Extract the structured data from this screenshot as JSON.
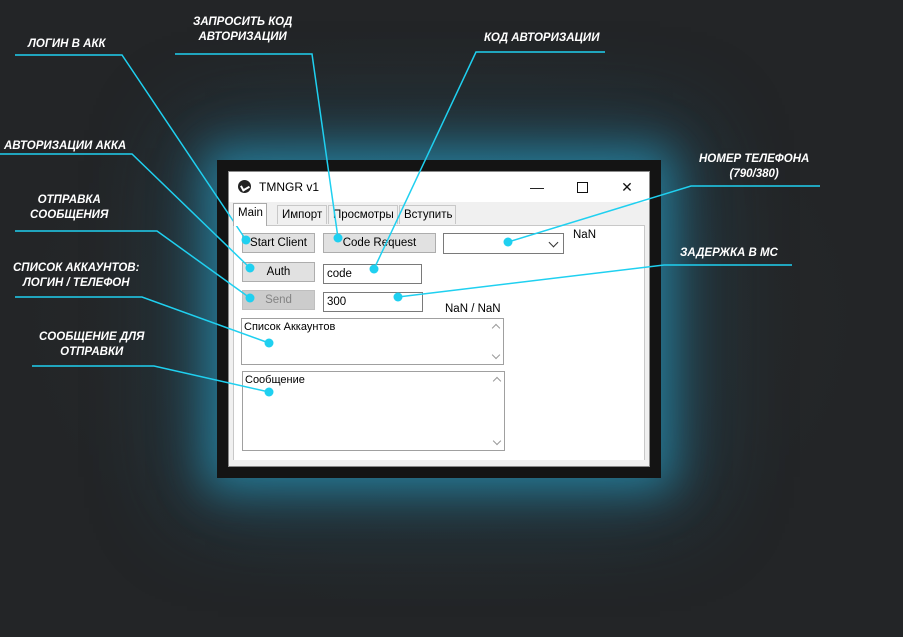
{
  "window": {
    "title": "TMNGR v1",
    "controls": {
      "minimize": "—",
      "maximize": "☐",
      "close": "✕"
    }
  },
  "tabs": [
    "Main",
    "Импорт",
    "Просмотры",
    "Вступить"
  ],
  "main": {
    "start_client_label": "Start Client",
    "code_request_label": "Code Request",
    "auth_label": "Auth",
    "send_label": "Send",
    "code_input_value": "code",
    "delay_input_value": "300",
    "phone_select_value": "",
    "phone_status": "NaN",
    "counter_status": "NaN / NaN",
    "accounts_list_text": "Список Аккаунтов",
    "message_text": "Сообщение"
  },
  "callouts": {
    "login": "ЛОГИН В АКК",
    "code_request": [
      "ЗАПРОСИТЬ КОД",
      "АВТОРИЗАЦИИ"
    ],
    "auth_code": "КОД АВТОРИЗАЦИИ",
    "authorization": "АВТОРИЗАЦИИ АККА",
    "send": [
      "ОТПРАВКА",
      "СООБЩЕНИЯ"
    ],
    "accounts_list": [
      "СПИСОК АККАУНТОВ:",
      "ЛОГИН / ТЕЛЕФОН"
    ],
    "message": [
      "СООБЩЕНИЕ ДЛЯ",
      "ОТПРАВКИ"
    ],
    "phone": [
      "НОМЕР ТЕЛЕФОНА",
      "(790/380)"
    ],
    "delay": "ЗАДЕРЖКА В МС"
  },
  "colors": {
    "accent": "#1fd0f0",
    "background": "#262626",
    "text": "#ffffff"
  }
}
